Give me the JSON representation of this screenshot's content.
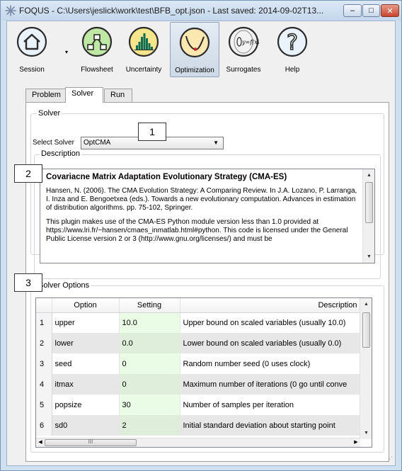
{
  "window": {
    "title": "FOQUS - C:\\Users\\jeslick\\work\\test\\BFB_opt.json - Last saved: 2014-09-02T13...",
    "controls": {
      "minimize": "–",
      "maximize": "□",
      "close": "✕"
    }
  },
  "toolbar": {
    "items": [
      {
        "label": "Session",
        "icon": "house-icon"
      },
      {
        "label": "Flowsheet",
        "icon": "flowsheet-icon"
      },
      {
        "label": "Uncertainty",
        "icon": "histogram-icon"
      },
      {
        "label": "Optimization",
        "icon": "optimization-curve-icon",
        "active": true
      },
      {
        "label": "Surrogates",
        "icon": "surrogate-function-icon",
        "icon_text": "y=f(x)"
      },
      {
        "label": "Help",
        "icon": "question-mark-icon",
        "icon_text": "?"
      }
    ],
    "session_dropdown": "▾"
  },
  "tabs": [
    {
      "label": "Problem"
    },
    {
      "label": "Solver",
      "selected": true
    },
    {
      "label": "Run"
    }
  ],
  "solver": {
    "group_title": "Solver",
    "select_label": "Select Solver",
    "select_value": "OptCMA",
    "description_title": "Description",
    "description": {
      "heading": "Covariacne Matrix Adaptation Evolutionary Strategy (CMA-ES)",
      "paragraph1": "Hansen, N. (2006). The CMA Evolution Strategy: A Comparing Review. In J.A. Lozano, P. Larranga, I. Inza and E. Bengoetxea (eds.). Towards a new evolutionary computation. Advances in estimation of distribution algorithms. pp. 75-102, Springer.",
      "paragraph2": "This plugin makes use of the CMA-ES Python module version less than 1.0 provided at https://www.lri.fr/~hansen/cmaes_inmatlab.html#python. This code is licensed under the General Public License version 2 or 3 (http://www.gnu.org/licenses/) and must be"
    }
  },
  "solver_options": {
    "group_title": "Solver Options",
    "columns": [
      "Option",
      "Setting",
      "Description"
    ],
    "rows": [
      {
        "num": "1",
        "option": "upper",
        "setting": "10.0",
        "description": "Upper bound on scaled variables (usually 10.0)"
      },
      {
        "num": "2",
        "option": "lower",
        "setting": "0.0",
        "description": "Lower bound on scaled variables (usually 0.0)"
      },
      {
        "num": "3",
        "option": "seed",
        "setting": "0",
        "description": "Random number seed (0 uses clock)"
      },
      {
        "num": "4",
        "option": "itmax",
        "setting": "0",
        "description": "Maximum number of iterations (0 go until conve"
      },
      {
        "num": "5",
        "option": "popsize",
        "setting": "30",
        "description": "Number of samples per iteration"
      },
      {
        "num": "6",
        "option": "sd0",
        "setting": "2",
        "description": "Initial standard deviation about starting point"
      }
    ],
    "hscroll_grip": "III"
  },
  "callouts": [
    "1",
    "2",
    "3"
  ],
  "colors": {
    "titlebar": "#c4d7ec",
    "setting_cell": "#eafbe6",
    "close_button": "#c8442d"
  }
}
